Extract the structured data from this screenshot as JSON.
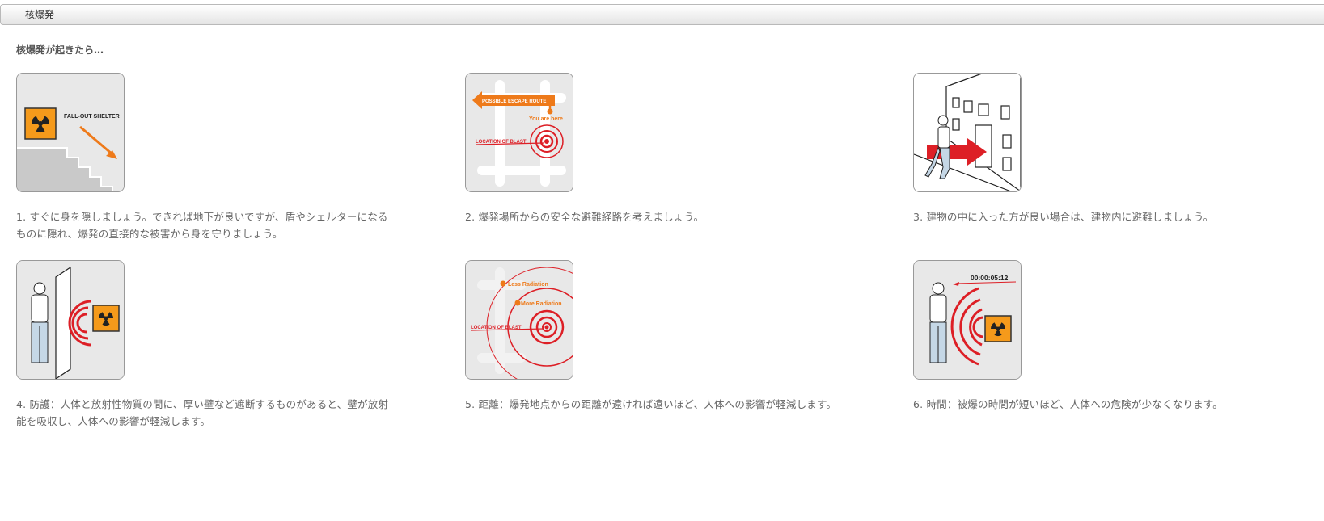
{
  "header": {
    "title": "核爆発"
  },
  "section": {
    "heading": "核爆発が起きたら…"
  },
  "cards": [
    {
      "caption": "1. すぐに身を隠しましょう。できれば地下が良いですが、盾やシェルターになるものに隠れ、爆発の直接的な被害から身を守りましょう。",
      "labels": {
        "sign": "FALL-OUT SHELTER"
      }
    },
    {
      "caption": "2. 爆発場所からの安全な避難経路を考えましょう。",
      "labels": {
        "route": "POSSIBLE ESCAPE ROUTE",
        "here": "You are here",
        "blast": "LOCATION OF BLAST"
      }
    },
    {
      "caption": "3. 建物の中に入った方が良い場合は、建物内に避難しましょう。",
      "labels": {}
    },
    {
      "caption": "4. 防護：人体と放射性物質の間に、厚い壁など遮断するものがあると、壁が放射能を吸収し、人体への影響が軽減します。",
      "labels": {}
    },
    {
      "caption": "5. 距離：爆発地点からの距離が遠ければ遠いほど、人体への影響が軽減します。",
      "labels": {
        "less": "Less Radiation",
        "more": "More Radiation",
        "blast": "LOCATION OF BLAST"
      }
    },
    {
      "caption": "6. 時間：被爆の時間が短いほど、人体への危険が少なくなります。",
      "labels": {
        "timer": "00:00:05:12"
      }
    }
  ],
  "colors": {
    "orange": "#ee7a1a",
    "red": "#dd1f26",
    "sign_yellow": "#f59a1b",
    "panel_bg": "#e8e8e8"
  },
  "icons": [
    "radiation-icon",
    "arrow-icon",
    "target-icon",
    "person-icon",
    "building-icon",
    "stairs-icon"
  ]
}
